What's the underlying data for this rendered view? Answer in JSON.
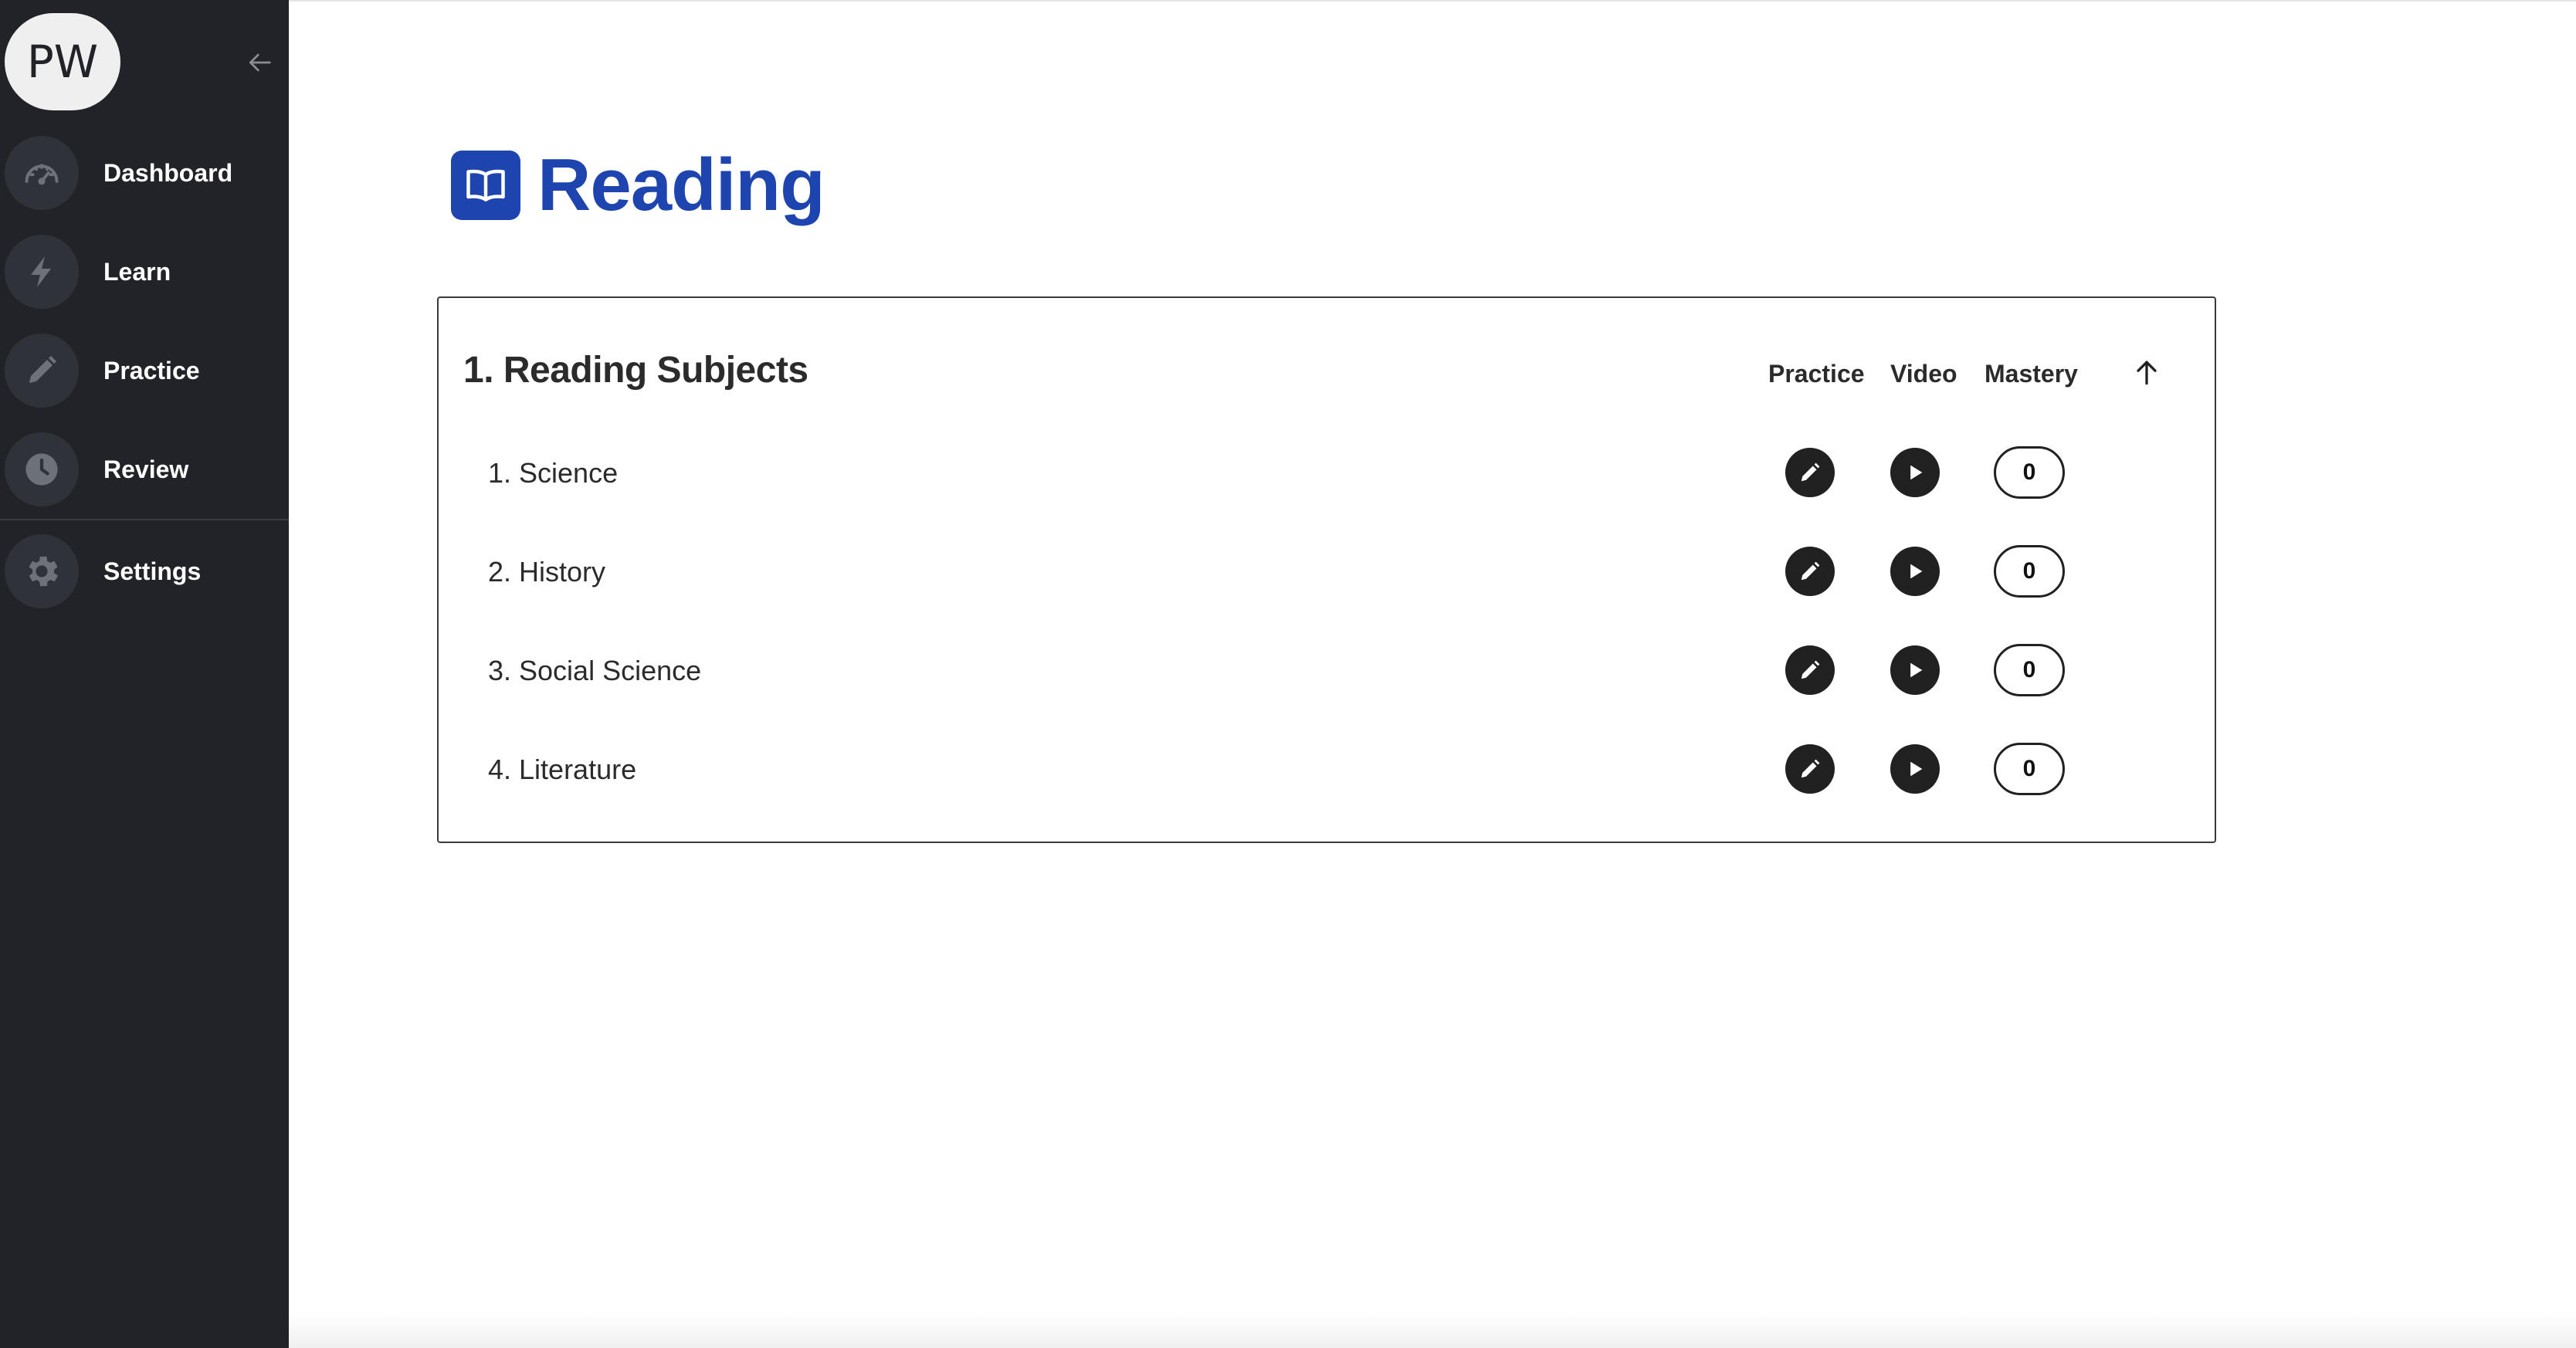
{
  "sidebar": {
    "avatar_initials": "PW",
    "collapse_icon": "arrow-left-icon",
    "items": [
      {
        "label": "Dashboard",
        "icon": "speedometer-icon"
      },
      {
        "label": "Learn",
        "icon": "lightning-icon"
      },
      {
        "label": "Practice",
        "icon": "pencil-icon"
      },
      {
        "label": "Review",
        "icon": "clock-icon"
      },
      {
        "label": "Settings",
        "icon": "gear-icon"
      }
    ]
  },
  "page": {
    "title": "Reading",
    "title_icon": "book-icon",
    "accent_color": "#1e44b0"
  },
  "section": {
    "title": "1. Reading Subjects",
    "columns": {
      "practice": "Practice",
      "video": "Video",
      "mastery": "Mastery"
    },
    "sort_icon": "arrow-up-icon",
    "rows": [
      {
        "label": "1. Science",
        "mastery": "0"
      },
      {
        "label": "2. History",
        "mastery": "0"
      },
      {
        "label": "3. Social Science",
        "mastery": "0"
      },
      {
        "label": "4. Literature",
        "mastery": "0"
      }
    ]
  }
}
